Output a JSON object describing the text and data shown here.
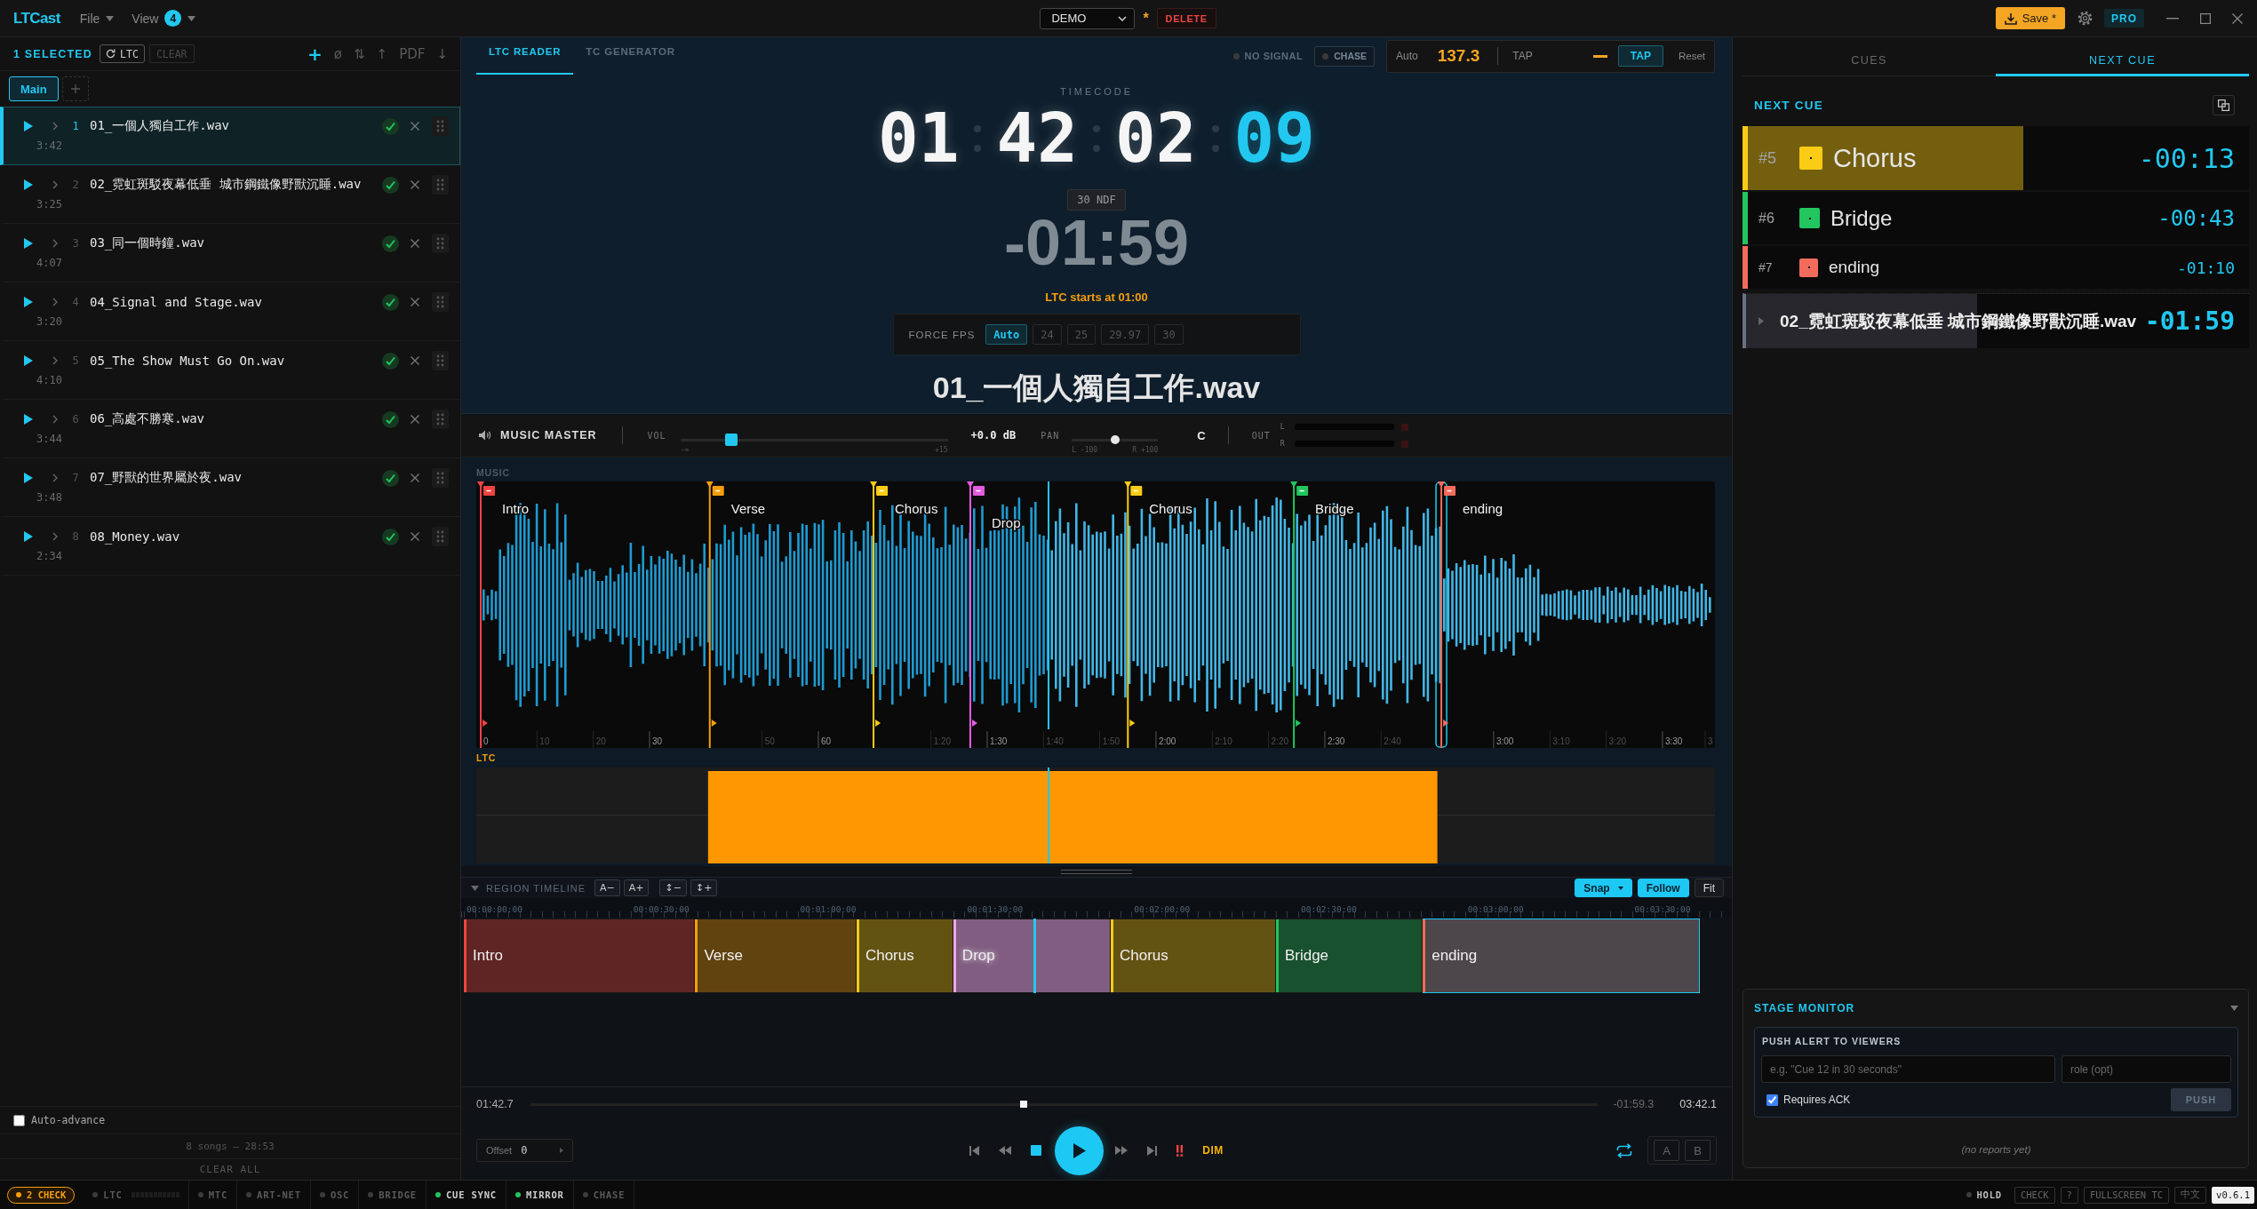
{
  "titlebar": {
    "logo": "LTCast",
    "menus": [
      {
        "label": "File"
      },
      {
        "label": "View",
        "badge": "4"
      }
    ],
    "project": "DEMO",
    "unsaved_mark": "*",
    "delete_label": "DELETE",
    "save_label": "Save *",
    "pro_label": "PRO"
  },
  "setlist": {
    "selection": "1 SELECTED",
    "ltc_button": "LTC",
    "clear_button": "CLEAR",
    "clear_disabled": true,
    "tools": [
      "+",
      "ø",
      "⇅",
      "↑",
      "PDF",
      "↓"
    ],
    "tabs": [
      {
        "label": "Main",
        "selected": true
      }
    ],
    "songs": [
      {
        "number": "1",
        "name": "01_一個人獨自工作.wav",
        "duration": "3:42",
        "selected": true,
        "ready": true
      },
      {
        "number": "2",
        "name": "02_霓虹斑駁夜幕低垂 城市鋼鐵像野獸沉睡.wav",
        "duration": "3:25",
        "selected": false,
        "ready": true
      },
      {
        "number": "3",
        "name": "03_同一個時鐘.wav",
        "duration": "4:07",
        "selected": false,
        "ready": true
      },
      {
        "number": "4",
        "name": "04_Signal and Stage.wav",
        "duration": "3:20",
        "selected": false,
        "ready": true
      },
      {
        "number": "5",
        "name": "05_The Show Must Go On.wav",
        "duration": "4:10",
        "selected": false,
        "ready": true
      },
      {
        "number": "6",
        "name": "06_高處不勝寒.wav",
        "duration": "3:44",
        "selected": false,
        "ready": true
      },
      {
        "number": "7",
        "name": "07_野獸的世界屬於夜.wav",
        "duration": "3:48",
        "selected": false,
        "ready": true
      },
      {
        "number": "8",
        "name": "08_Money.wav",
        "duration": "2:34",
        "selected": false,
        "ready": true
      }
    ],
    "auto_advance": {
      "label": "Auto-advance",
      "checked": false
    },
    "summary": "8 songs — 28:53",
    "clear_all": "CLEAR ALL"
  },
  "reader": {
    "tabs": [
      {
        "label": "LTC READER",
        "selected": true
      },
      {
        "label": "TC GENERATOR",
        "selected": false
      }
    ],
    "signal": {
      "label": "NO SIGNAL",
      "on": false
    },
    "chase": {
      "label": "CHASE",
      "on": false
    },
    "bpm": {
      "mode": "Auto",
      "value": "137.3",
      "tap_label": "TAP",
      "tap_button": "TAP",
      "reset": "Reset"
    },
    "timecode": {
      "label": "TIMECODE",
      "hours": "01",
      "minutes": "42",
      "seconds": "02",
      "frames": "09"
    },
    "fps_badge": "30 NDF",
    "remaining": "-01:59",
    "ltc_start": "LTC starts at 01:00",
    "force_fps": {
      "label": "FORCE FPS",
      "options": [
        {
          "label": "Auto",
          "selected": true
        },
        {
          "label": "24",
          "selected": false
        },
        {
          "label": "25",
          "selected": false
        },
        {
          "label": "29.97",
          "selected": false
        },
        {
          "label": "30",
          "selected": false
        }
      ]
    },
    "song_title": "01_一個人獨自工作.wav"
  },
  "mixer": {
    "name": "MUSIC MASTER",
    "volume": {
      "label": "VOL",
      "level": 0.19,
      "min": "-∞",
      "max": "+15",
      "reading": "+0.0 dB"
    },
    "pan": {
      "label": "PAN",
      "level": 0.5,
      "min": "L -100",
      "max": "R +100",
      "reading": "C"
    },
    "output": {
      "label": "OUT",
      "channels": [
        {
          "name": "L",
          "level": 0,
          "clip": false
        },
        {
          "name": "R",
          "level": 0,
          "clip": false
        }
      ]
    }
  },
  "waveform": {
    "label": "MUSIC",
    "markers": [
      {
        "label": "Intro",
        "color": "#ef4444",
        "selected": false
      },
      {
        "label": "Verse",
        "color": "#f59e0b",
        "selected": false
      },
      {
        "label": "Chorus",
        "color": "#facc15",
        "selected": false
      },
      {
        "label": "Drop",
        "color": "#e45be0",
        "selected": false
      },
      {
        "label": "Chorus",
        "color": "#facc15",
        "selected": false
      },
      {
        "label": "Bridge",
        "color": "#22c55e",
        "selected": false
      },
      {
        "label": "ending",
        "color": "#f26b5b",
        "selected": true
      }
    ],
    "axis_labels": [
      "0",
      "10",
      "20",
      "30",
      "50",
      "60",
      "1:20",
      "1:30",
      "1:40",
      "1:50",
      "2:00",
      "2:10",
      "2:20",
      "2:30",
      "2:40",
      "3:00",
      "3:10",
      "3:20",
      "3:30",
      "3"
    ],
    "ltc_label": "LTC"
  },
  "region_timeline": {
    "title": "REGION TIMELINE",
    "expanded": true,
    "zoom_buttons": [
      "A−",
      "A+",
      "↕−",
      "↕+"
    ],
    "toggles": [
      {
        "label": "Snap",
        "on": true,
        "kind": "dropdown"
      },
      {
        "label": "Follow",
        "on": true,
        "kind": "toggle"
      },
      {
        "label": "Fit",
        "on": false,
        "kind": "toggle"
      }
    ],
    "ruler": [
      "00:00:00:00",
      "00:00:30:00",
      "00:01:00:00",
      "00:01:30:00",
      "00:02:00:00",
      "00:02:30:00",
      "00:03:00:00",
      "00:03:30:00"
    ],
    "regions": [
      {
        "label": "Intro",
        "color": "#ef4444",
        "selected": false,
        "active": false
      },
      {
        "label": "Verse",
        "color": "#f59e0b",
        "selected": false,
        "active": false
      },
      {
        "label": "Chorus",
        "color": "#facc15",
        "selected": false,
        "active": false
      },
      {
        "label": "Drop",
        "color": "#f0a8f0",
        "selected": false,
        "active": true
      },
      {
        "label": "Chorus",
        "color": "#facc15",
        "selected": false,
        "active": false
      },
      {
        "label": "Bridge",
        "color": "#22c55e",
        "selected": false,
        "active": false
      },
      {
        "label": "ending",
        "color": "#f26b5b",
        "selected": true,
        "active": false
      }
    ]
  },
  "transport": {
    "position": "01:42.7",
    "level": 0.462,
    "remaining": "-01:59.3",
    "total": "03:42.1",
    "offset": {
      "label": "Offset",
      "value": "0"
    },
    "dim": "DIM",
    "loop": true,
    "ab": [
      {
        "label": "A",
        "on": false
      },
      {
        "label": "B",
        "on": false
      }
    ]
  },
  "cue_panel": {
    "tabs": [
      {
        "label": "CUES",
        "selected": false
      },
      {
        "label": "NEXT CUE",
        "selected": true
      }
    ],
    "heading": "NEXT CUE",
    "cues": [
      {
        "number": "#5",
        "label": "Chorus",
        "countdown": "-00:13",
        "color": "#facc15",
        "level": 0.55
      },
      {
        "number": "#6",
        "label": "Bridge",
        "countdown": "-00:43",
        "color": "#22c55e"
      },
      {
        "number": "#7",
        "label": "ending",
        "countdown": "-01:10",
        "color": "#f26b5b"
      }
    ],
    "next_song": {
      "name": "02_霓虹斑駁夜幕低垂 城市鋼鐵像野獸沉睡.wav",
      "countdown": "-01:59",
      "level": 0.46
    }
  },
  "stage_monitor": {
    "title": "STAGE MONITOR",
    "expanded": true,
    "push_title": "PUSH ALERT TO VIEWERS",
    "message_placeholder": "e.g. \"Cue 12 in 30 seconds\"",
    "role_placeholder": "role (opt)",
    "requires_ack": {
      "label": "Requires ACK",
      "checked": true
    },
    "push": {
      "label": "PUSH",
      "disabled": true
    },
    "reports": "(no reports yet)"
  },
  "status_bar": {
    "alert": "2 CHECK",
    "items": [
      {
        "label": "LTC",
        "on": false,
        "kind": "meter",
        "level": 0
      },
      {
        "label": "MTC",
        "on": false,
        "kind": "plain"
      },
      {
        "label": "ART-NET",
        "on": false,
        "kind": "plain"
      },
      {
        "label": "OSC",
        "on": false,
        "kind": "plain"
      },
      {
        "label": "BRIDGE",
        "on": false,
        "kind": "plain"
      },
      {
        "label": "CUE SYNC",
        "on": true,
        "kind": "plain"
      },
      {
        "label": "MIRROR",
        "on": true,
        "kind": "plain"
      },
      {
        "label": "CHASE",
        "on": false,
        "kind": "plain"
      }
    ],
    "hold": {
      "label": "HOLD",
      "on": false
    },
    "buttons": [
      "CHECK",
      "?",
      "FULLSCREEN TC",
      "中文"
    ],
    "version": "v0.6.1"
  }
}
